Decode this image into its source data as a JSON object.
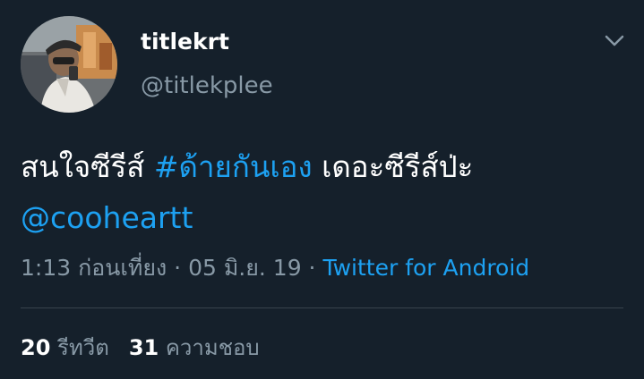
{
  "tweet": {
    "author": {
      "display_name": "titlekrt",
      "handle": "@titlekplee",
      "avatar_icon": "user-avatar-photo"
    },
    "menu_icon": "chevron-down-icon",
    "body": {
      "text_prefix": "สนใจซีรีส์ ",
      "hashtag": "#ด้ายกันเอง",
      "text_middle": " เดอะซีรีส์ป่ะ",
      "mention": "@cooheartt"
    },
    "meta": {
      "time": "1:13 ก่อนเที่ยง",
      "separator": " · ",
      "date": "05 มิ.ย. 19",
      "source": "Twitter for Android"
    },
    "stats": {
      "retweets_count": "20",
      "retweets_label": "รีทวีต",
      "likes_count": "31",
      "likes_label": "ความชอบ"
    }
  },
  "colors": {
    "background": "#15202b",
    "text_primary": "#ffffff",
    "text_secondary": "#8899a6",
    "accent": "#1da1f2",
    "divider": "#38444d"
  }
}
